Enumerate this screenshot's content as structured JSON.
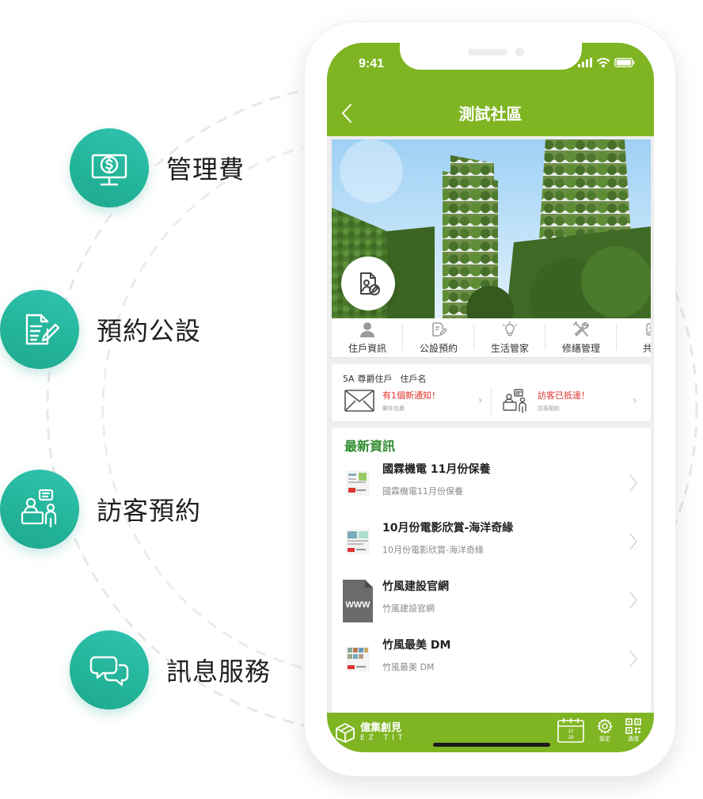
{
  "features": [
    {
      "label": "管理費",
      "icon": "monitor-dollar-icon"
    },
    {
      "label": "預約公設",
      "icon": "document-edit-icon"
    },
    {
      "label": "訪客預約",
      "icon": "visitor-reception-icon"
    },
    {
      "label": "訊息服務",
      "icon": "chat-bubbles-icon"
    }
  ],
  "status_bar": {
    "time": "9:41"
  },
  "navbar": {
    "title": "測試社區"
  },
  "menu": [
    {
      "label": "住戶資訊",
      "icon": "person-icon"
    },
    {
      "label": "公設預約",
      "icon": "edit-document-icon"
    },
    {
      "label": "生活管家",
      "icon": "lightbulb-icon"
    },
    {
      "label": "修繕管理",
      "icon": "tools-icon"
    },
    {
      "label": "共享",
      "icon": "share-icon"
    }
  ],
  "resident": {
    "unit": "5A",
    "title": "尊爵住戶",
    "name": "住戶名",
    "notice_mail_main": "有1個新通知！",
    "notice_mail_sub": "郵件包裹",
    "notice_visitor_main": "訪客已抵達！",
    "notice_visitor_sub": "訪客預約"
  },
  "news": {
    "heading": "最新資訊",
    "items": [
      {
        "title": "國霖機電 11月份保養",
        "subtitle": "國霖機電11月份保養"
      },
      {
        "title": "10月份電影欣賞-海洋奇緣",
        "subtitle": "10月份電影欣賞-海洋奇緣"
      },
      {
        "title": "竹風建設官網",
        "subtitle": "竹風建設官網"
      },
      {
        "title": "竹風最美 DM",
        "subtitle": "竹風最美 DM"
      }
    ],
    "www_label": "WWW"
  },
  "tabbar": {
    "brand_name": "億集創見",
    "brand_en": "EZ TIT",
    "calendar_top": "12",
    "calendar_day": "28",
    "settings_label": "設定",
    "qr_label": "憑證"
  },
  "colors": {
    "accent": "#7fb522",
    "teal": "#24b59a",
    "alert": "#e0322a",
    "news_heading": "#2d8b2d"
  }
}
